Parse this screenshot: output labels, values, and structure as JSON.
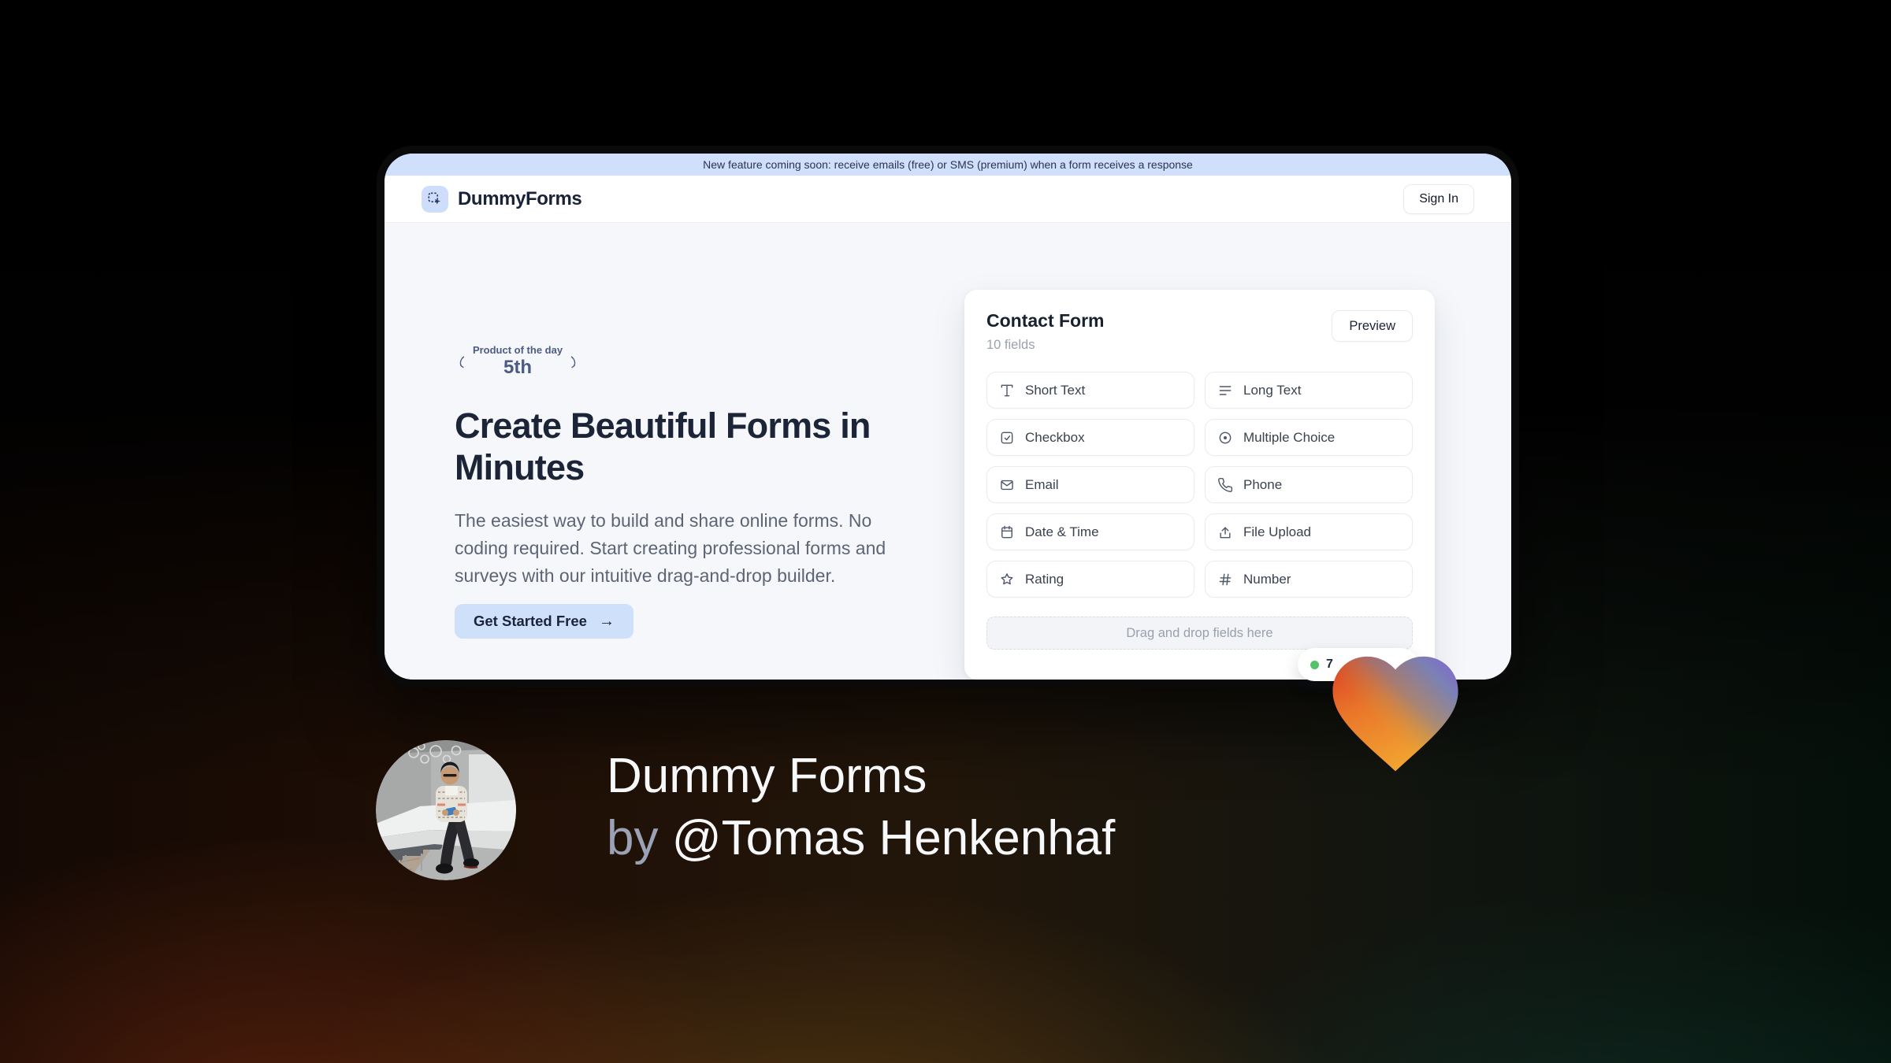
{
  "banner": {
    "text": "New feature coming soon: receive emails (free) or SMS (premium) when a form receives a response"
  },
  "nav": {
    "brand": "DummyForms",
    "sign_in_label": "Sign In"
  },
  "hero": {
    "award_badge": {
      "title": "Product of the day",
      "rank": "5th"
    },
    "heading_line1": "Create Beautiful Forms in",
    "heading_line2": "Minutes",
    "description": "The easiest way to build and share online forms. No coding required. Start creating professional forms and surveys with our intuitive drag-and-drop builder.",
    "cta_label": "Get Started Free",
    "cta_arrow": "→"
  },
  "form_builder": {
    "title": "Contact Form",
    "field_count": "10 fields",
    "preview_label": "Preview",
    "fields": [
      {
        "label": "Short Text",
        "icon": "short-text-icon"
      },
      {
        "label": "Long Text",
        "icon": "long-text-icon"
      },
      {
        "label": "Checkbox",
        "icon": "checkbox-icon"
      },
      {
        "label": "Multiple Choice",
        "icon": "multiple-choice-icon"
      },
      {
        "label": "Email",
        "icon": "email-icon"
      },
      {
        "label": "Phone",
        "icon": "phone-icon"
      },
      {
        "label": "Date & Time",
        "icon": "calendar-icon"
      },
      {
        "label": "File Upload",
        "icon": "upload-icon"
      },
      {
        "label": "Rating",
        "icon": "star-icon"
      },
      {
        "label": "Number",
        "icon": "hash-icon"
      }
    ],
    "dropzone_text": "Drag and drop fields here",
    "live_badge": {
      "text": "7"
    }
  },
  "caption": {
    "title": "Dummy Forms",
    "byline_prefix": "by",
    "byline_name": "@Tomas Henkenhaf"
  },
  "colors": {
    "accent_blue": "#cfe0fb",
    "banner_blue": "#cfdffc",
    "brand_navy": "#1c2537",
    "badge_green": "#54c268",
    "laurel_slate": "#4b5b83",
    "heart_gradient": [
      "#da3b24",
      "#e9752a",
      "#f2a431",
      "#7582bb",
      "#8067d4"
    ]
  }
}
